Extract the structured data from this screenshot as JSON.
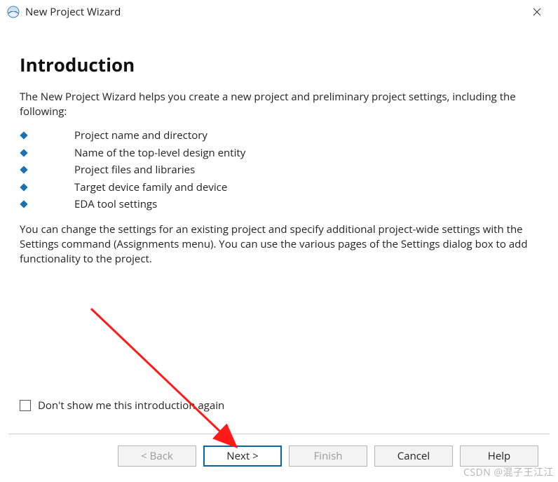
{
  "window": {
    "title": "New Project Wizard"
  },
  "page": {
    "heading": "Introduction",
    "intro_paragraph": "The New Project Wizard helps you create a new project and preliminary project settings, including the following:",
    "bullets": [
      "Project name and directory",
      "Name of the top-level design entity",
      "Project files and libraries",
      "Target device family and device",
      "EDA tool settings"
    ],
    "second_paragraph": "You can change the settings for an existing project and specify additional project-wide settings with the Settings command (Assignments menu). You can use the various pages of the Settings dialog box to add functionality to the project.",
    "checkbox_label": "Don't show me this introduction again"
  },
  "buttons": {
    "back": "< Back",
    "next": "Next >",
    "finish": "Finish",
    "cancel": "Cancel",
    "help": "Help"
  },
  "watermark": "CSDN @混子王江江"
}
